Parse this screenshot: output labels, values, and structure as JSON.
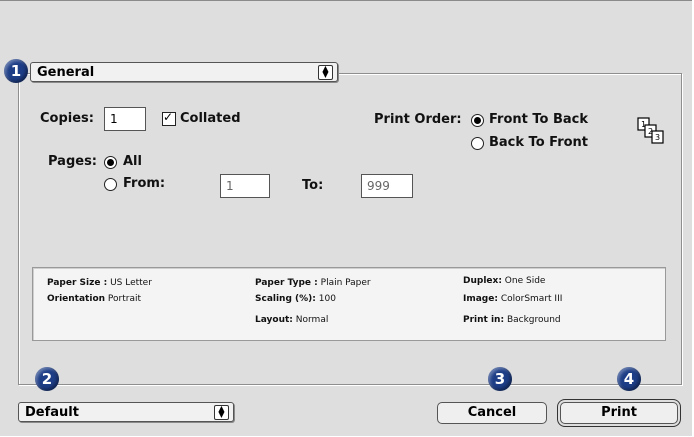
{
  "markers": {
    "one": "1",
    "two": "2",
    "three": "3",
    "four": "4"
  },
  "panel_popup": {
    "value": "General"
  },
  "copies": {
    "label": "Copies:",
    "value": "1",
    "collated_label": "Collated",
    "collated": true
  },
  "pages": {
    "label": "Pages:",
    "all_label": "All",
    "from_label": "From:",
    "from_value": "1",
    "to_label": "To:",
    "to_value": "999",
    "selected": "All"
  },
  "print_order": {
    "label": "Print Order:",
    "front_to_back": "Front To Back",
    "back_to_front": "Back To Front",
    "selected": "Front To Back"
  },
  "summary": {
    "paper_size_label": "Paper Size :",
    "paper_size": "US Letter",
    "orientation_label": "Orientation",
    "orientation": "Portrait",
    "paper_type_label": "Paper Type :",
    "paper_type": "Plain Paper",
    "scaling_label": "Scaling (%):",
    "scaling": "100",
    "layout_label": "Layout:",
    "layout": "Normal",
    "duplex_label": "Duplex:",
    "duplex": "One Side",
    "image_label": "Image:",
    "image": "ColorSmart III",
    "print_in_label": "Print in:",
    "print_in": "Background"
  },
  "presets": {
    "value": "Default"
  },
  "buttons": {
    "cancel": "Cancel",
    "print": "Print"
  },
  "colors": {
    "badge": "#1d3d86",
    "dialog_bg": "#dedede"
  }
}
